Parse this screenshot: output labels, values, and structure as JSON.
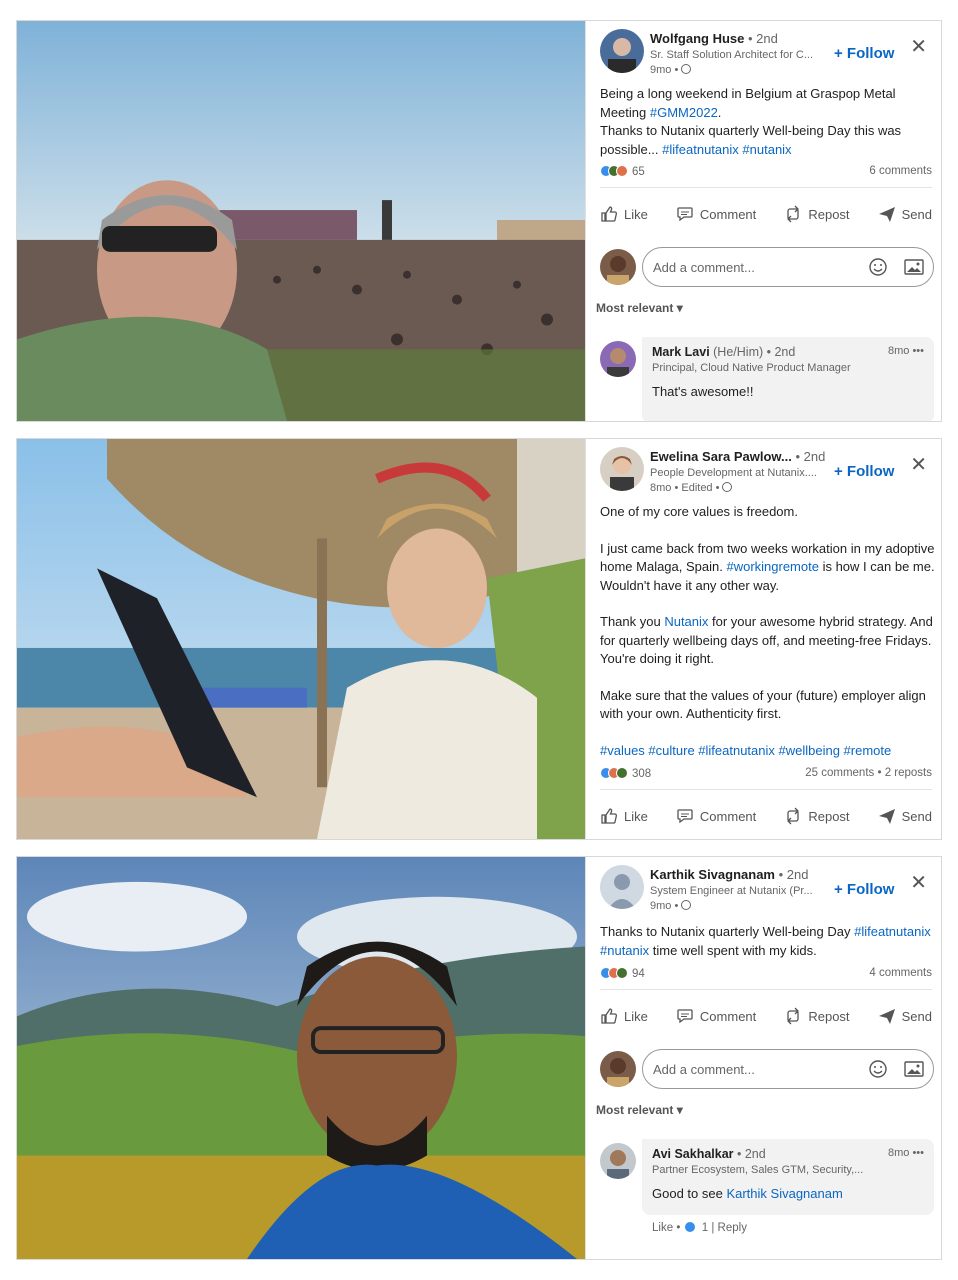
{
  "posts": [
    {
      "author": {
        "name": "Wolfgang Huse",
        "degree": " • 2nd",
        "title": "Sr. Staff Solution Architect for C...",
        "time": "9mo •"
      },
      "follow_label": "+ Follow",
      "close_label": "✕",
      "text": {
        "line1a": "Being a long weekend in Belgium at Graspop Metal Meeting ",
        "tag1": "#GMM2022",
        "line1b": ".",
        "line2a": "Thanks to Nutanix quarterly Well-being Day this was possible... ",
        "tag2": "#lifeatnutanix",
        "tag3": "#nutanix"
      },
      "reactions": "65",
      "comments": "6 comments",
      "actions": {
        "like": "Like",
        "comment": "Comment",
        "repost": "Repost",
        "send": "Send"
      },
      "comment_placeholder": "Add a comment...",
      "sort_label": "Most relevant ▾",
      "top_comment": {
        "name": "Mark Lavi",
        "pronoun": " (He/Him)",
        "degree": " • 2nd",
        "title": "Principal, Cloud Native Product Manager",
        "time": "8mo •••",
        "text": "That's awesome!!"
      }
    },
    {
      "author": {
        "name": "Ewelina Sara Pawlow...",
        "degree": " • 2nd",
        "title": "People Development at Nutanix....",
        "time": "8mo • Edited •"
      },
      "follow_label": "+ Follow",
      "close_label": "✕",
      "text": {
        "p1": "One of my core values is freedom.",
        "p2a": "I just came back from two weeks workation in my adoptive home Malaga, Spain. ",
        "p2tag": "#workingremote",
        "p2b": " is how I can be me. Wouldn't have it any other way.",
        "p3a": "Thank you ",
        "p3tag": "Nutanix",
        "p3b": " for your awesome hybrid strategy. And for quarterly wellbeing days off, and meeting-free Fridays. You're doing it right.",
        "p4": "Make sure that the values of your (future) employer align with your own. Authenticity first.",
        "tags": "#values #culture #lifeatnutanix #wellbeing #remote"
      },
      "reactions": "308",
      "comments": "25 comments • 2 reposts",
      "actions": {
        "like": "Like",
        "comment": "Comment",
        "repost": "Repost",
        "send": "Send"
      }
    },
    {
      "author": {
        "name": "Karthik Sivagnanam",
        "degree": " • 2nd",
        "title": "System Engineer at Nutanix (Pr...",
        "time": "9mo •"
      },
      "follow_label": "+ Follow",
      "close_label": "✕",
      "text": {
        "line1": "Thanks to Nutanix quarterly Well-being Day ",
        "tag1": "#lifeatnutanix",
        "tag2": "#nutanix",
        "line2": " time well spent with my kids."
      },
      "reactions": "94",
      "comments": "4 comments",
      "actions": {
        "like": "Like",
        "comment": "Comment",
        "repost": "Repost",
        "send": "Send"
      },
      "comment_placeholder": "Add a comment...",
      "sort_label": "Most relevant ▾",
      "top_comment": {
        "name": "Avi Sakhalkar",
        "degree": " • 2nd",
        "title": "Partner Ecosystem, Sales GTM, Security,...",
        "time": "8mo •••",
        "text": "Good to see ",
        "mention": "Karthik Sivagnanam",
        "like_label": "Like",
        "like_count": "1",
        "reply_label": "Reply"
      }
    }
  ],
  "colors": {
    "link": "#0a66c2",
    "muted": "#666666",
    "like_blue": "#378fe9",
    "heart_red": "#df704d",
    "celebrate_green": "#44712e"
  }
}
